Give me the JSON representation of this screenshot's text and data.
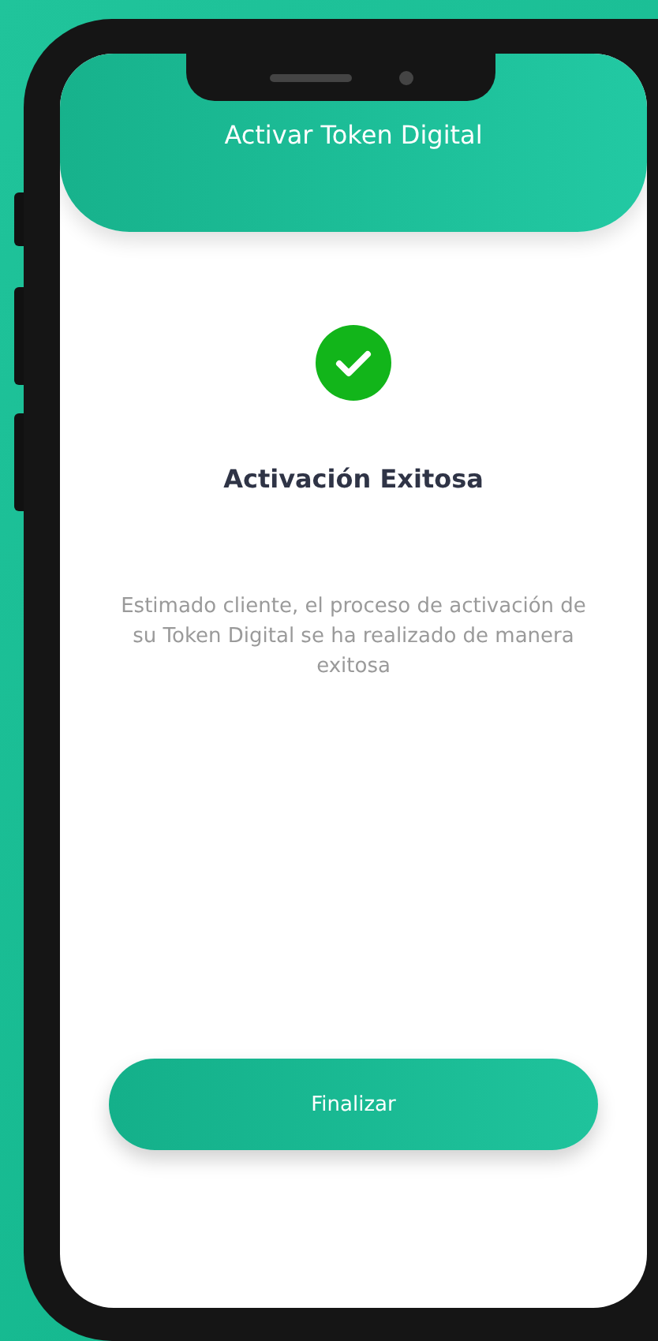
{
  "header": {
    "title": "Activar Token Digital"
  },
  "result": {
    "title": "Activación Exitosa",
    "message": "Estimado cliente, el proceso de activación de su Token Digital se ha realizado de manera exitosa"
  },
  "buttons": [
    {
      "label": "Finalizar"
    }
  ]
}
